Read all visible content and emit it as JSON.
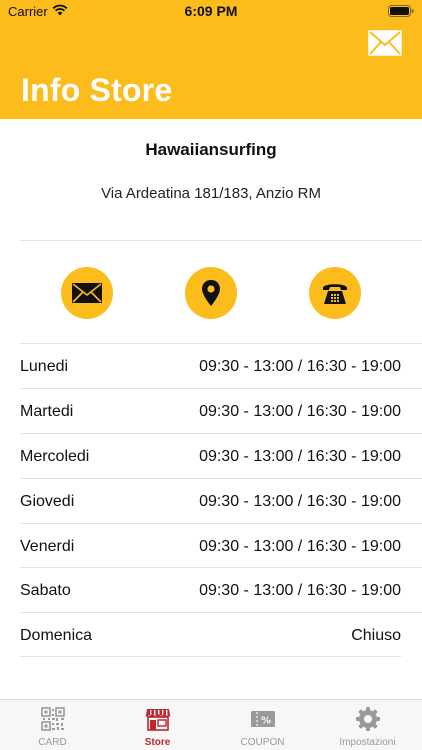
{
  "status_bar": {
    "carrier": "Carrier",
    "time": "6:09 PM"
  },
  "header": {
    "title": "Info Store",
    "mail_icon": "envelope-icon"
  },
  "store": {
    "name": "Hawaiiansurfing",
    "address": "Via Ardeatina 181/183, Anzio RM"
  },
  "actions": [
    {
      "icon": "envelope-icon",
      "purpose": "email"
    },
    {
      "icon": "location-pin-icon",
      "purpose": "map"
    },
    {
      "icon": "telephone-icon",
      "purpose": "call"
    }
  ],
  "hours": [
    {
      "day": "Lunedi",
      "time": "09:30 - 13:00 / 16:30 - 19:00"
    },
    {
      "day": "Martedi",
      "time": "09:30 - 13:00 / 16:30 - 19:00"
    },
    {
      "day": "Mercoledi",
      "time": "09:30 - 13:00 / 16:30 - 19:00"
    },
    {
      "day": "Giovedi",
      "time": "09:30 - 13:00 / 16:30 - 19:00"
    },
    {
      "day": "Venerdi",
      "time": "09:30 - 13:00 / 16:30 - 19:00"
    },
    {
      "day": "Sabato",
      "time": "09:30 - 13:00 / 16:30 - 19:00"
    },
    {
      "day": "Domenica",
      "time": "Chiuso"
    }
  ],
  "tabbar": {
    "active": "Store",
    "tabs": [
      {
        "label": "CARD",
        "icon": "qr-code-icon"
      },
      {
        "label": "Store",
        "icon": "storefront-icon"
      },
      {
        "label": "COUPON",
        "icon": "coupon-icon"
      },
      {
        "label": "Impostazioni",
        "icon": "gear-icon"
      }
    ]
  },
  "colors": {
    "accent": "#FBBC1C",
    "active_tab": "#C0262C",
    "inactive_tab": "#9A9A9A",
    "divider": "#E2E2E2"
  }
}
